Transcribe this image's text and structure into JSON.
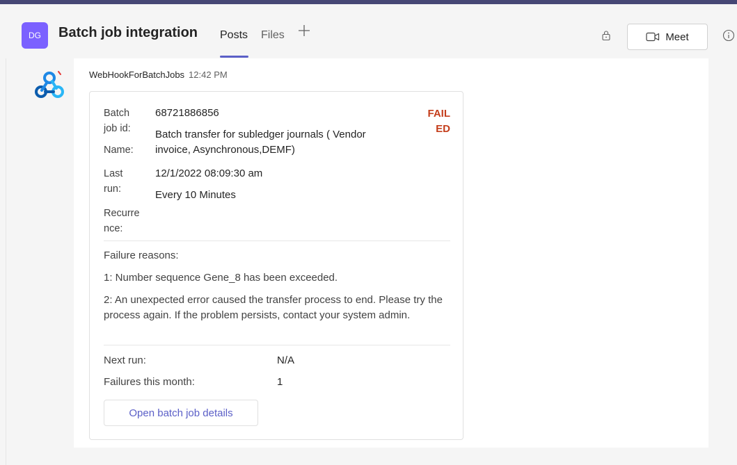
{
  "header": {
    "avatar_initials": "DG",
    "channel_title": "Batch job integration",
    "tabs": [
      {
        "label": "Posts",
        "active": true
      },
      {
        "label": "Files",
        "active": false
      }
    ],
    "add_tab_icon": "plus-icon",
    "meet_label": "Meet",
    "meet_icon": "video-camera-icon",
    "lock_icon": "lock-icon",
    "info_icon": "info-icon"
  },
  "message": {
    "sender": "WebHookForBatchJobs",
    "time": "12:42 PM",
    "bot_icon": "webhook-icon"
  },
  "card": {
    "status": [
      "FAIL",
      "ED"
    ],
    "facts": {
      "batch_job_id_label": [
        "Batch",
        "job id:"
      ],
      "batch_job_id_value": "68721886856",
      "name_label": "Name:",
      "name_value": [
        "Batch transfer for subledger journals ( Vendor",
        "invoice, Asynchronous,DEMF)"
      ],
      "last_run_label": [
        "Last",
        "run:"
      ],
      "last_run_value": "12/1/2022 08:09:30 am",
      "recurrence_label": [
        "Recurre",
        "nce:"
      ],
      "recurrence_value": "Every 10 Minutes"
    },
    "failure_heading": "Failure reasons:",
    "failure_reasons": [
      "1: Number sequence Gene_8 has been exceeded.",
      "2: An unexpected error caused the transfer process to end. Please try the process again. If the problem persists, contact your system admin."
    ],
    "next_run_label": "Next run:",
    "next_run_value": "N/A",
    "failures_label": "Failures this month:",
    "failures_value": "1",
    "action_label": "Open batch job details"
  },
  "colors": {
    "accent": "#5b5fc7",
    "failed": "#c43e1c",
    "avatar": "#7b61ff",
    "topbar": "#464775"
  }
}
